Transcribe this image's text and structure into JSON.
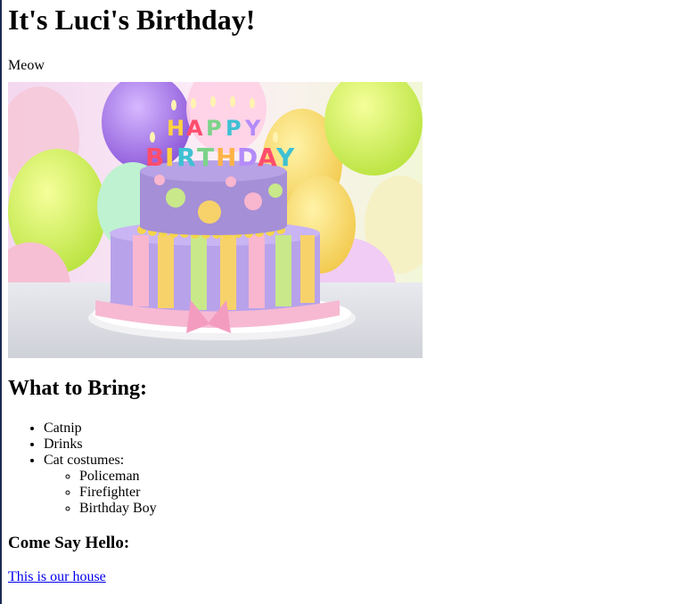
{
  "page": {
    "title": "It's Luci's Birthday!",
    "subtitle": "Meow"
  },
  "image": {
    "alt": "Birthday cake"
  },
  "bring": {
    "heading": "What to Bring:",
    "items": [
      "Catnip",
      "Drinks",
      "Cat costumes:"
    ],
    "costumes": [
      "Policeman",
      "Firefighter",
      "Birthday Boy"
    ]
  },
  "hello": {
    "heading": "Come Say Hello:",
    "link_text": "This is our house"
  },
  "colors": {
    "link": "#0000ee",
    "cake_top": "#a58fd6",
    "candle_letters": [
      "#ff4d6d",
      "#ffd23f",
      "#3ec1d3",
      "#7bd389",
      "#b38bfa"
    ]
  }
}
